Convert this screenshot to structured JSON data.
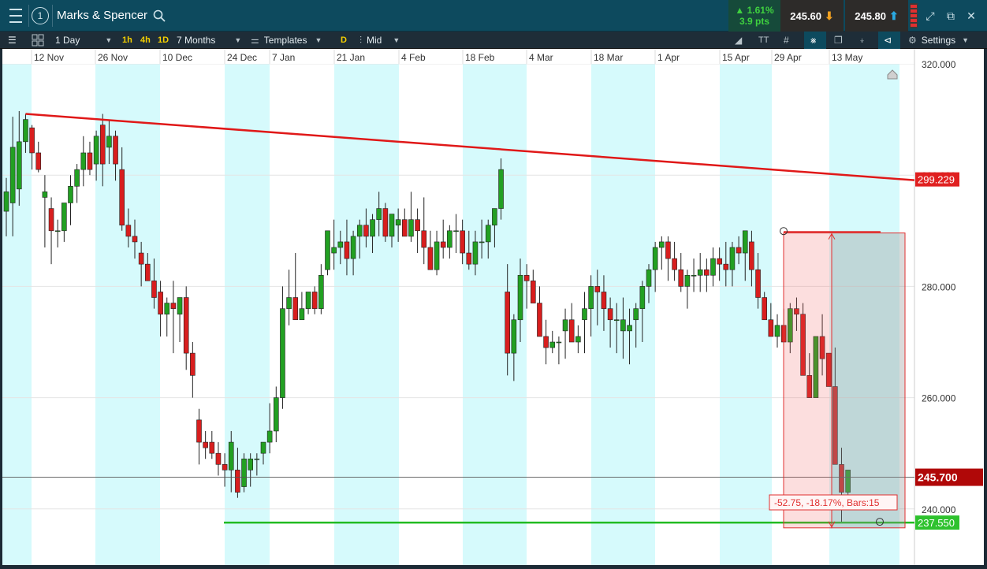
{
  "header": {
    "instrument": "Marks & Spencer",
    "info_badge": "1",
    "change_pct": "1.61%",
    "change_pts": "3.9 pts",
    "sell_price": "245.60",
    "buy_price": "245.80"
  },
  "toolbar": {
    "interval": "1 Day",
    "quick_intervals": [
      "1h",
      "4h",
      "1D"
    ],
    "range": "7 Months",
    "templates": "Templates",
    "price_type_badge": "D",
    "price_type": "Mid",
    "settings": "Settings"
  },
  "colors": {
    "up_candle": "#22a022",
    "down_candle": "#d81e1e",
    "trendline": "#e01818",
    "support": "#22bb22",
    "shade": "#d6fafc"
  },
  "chart_data": {
    "type": "candlestick",
    "x_labels": [
      "12 Nov",
      "26 Nov",
      "10 Dec",
      "24 Dec",
      "7 Jan",
      "21 Jan",
      "4 Feb",
      "18 Feb",
      "4 Mar",
      "18 Mar",
      "1 Apr",
      "15 Apr",
      "29 Apr",
      "13 May"
    ],
    "y_ticks": [
      "320.000",
      "300.000",
      "280.000",
      "260.000",
      "240.000"
    ],
    "y_range": [
      237,
      321
    ],
    "price_tags": {
      "trendline": "299.229",
      "current": "245.700",
      "support": "237.550"
    },
    "measure_label": "-52.75, -18.17%, Bars:15",
    "candles": [
      [
        293.5,
        299.5,
        289,
        297
      ],
      [
        295,
        310.5,
        289,
        305
      ],
      [
        297.5,
        311.5,
        294.5,
        306
      ],
      [
        306,
        311,
        304,
        310
      ],
      [
        308.5,
        309,
        301,
        304
      ],
      [
        304,
        306,
        300.5,
        301
      ],
      [
        296,
        300,
        287,
        297
      ],
      [
        294,
        296,
        284,
        290
      ],
      [
        290,
        292,
        287,
        290
      ],
      [
        290,
        294,
        288,
        295
      ],
      [
        295,
        300,
        291,
        298
      ],
      [
        298,
        302,
        295,
        301
      ],
      [
        301,
        307,
        298,
        304
      ],
      [
        304,
        306,
        300,
        301
      ],
      [
        302,
        308,
        299,
        307
      ],
      [
        309,
        311,
        298,
        302
      ],
      [
        305,
        310,
        302,
        307
      ],
      [
        307,
        308,
        299,
        302
      ],
      [
        301,
        305,
        290,
        291
      ],
      [
        291,
        294,
        287,
        289
      ],
      [
        289,
        292,
        285,
        288
      ],
      [
        286,
        288,
        280,
        284
      ],
      [
        284,
        286,
        281,
        281
      ],
      [
        281,
        285,
        276,
        278
      ],
      [
        279,
        281,
        271,
        275
      ],
      [
        275,
        278,
        271,
        277
      ],
      [
        277,
        281,
        268,
        276
      ],
      [
        275,
        278,
        270,
        278
      ],
      [
        278,
        280,
        265,
        268
      ],
      [
        268,
        270,
        260,
        264
      ],
      [
        256,
        258,
        248,
        252
      ],
      [
        252,
        254,
        249,
        251
      ],
      [
        252,
        254,
        249,
        250
      ],
      [
        250,
        252,
        246,
        248
      ],
      [
        248,
        250,
        244,
        247
      ],
      [
        247,
        254,
        243,
        252
      ],
      [
        247,
        251,
        242,
        243
      ],
      [
        244,
        250,
        243,
        249
      ],
      [
        247,
        250,
        244,
        249
      ],
      [
        249,
        250,
        246,
        249
      ],
      [
        250,
        252,
        248,
        252
      ],
      [
        252,
        259,
        250,
        254
      ],
      [
        254,
        262,
        252,
        260
      ],
      [
        260,
        280,
        258,
        276
      ],
      [
        276,
        283,
        273,
        278
      ],
      [
        278,
        286,
        274,
        274
      ],
      [
        274,
        279,
        274,
        276
      ],
      [
        276,
        279,
        275,
        279
      ],
      [
        279,
        280,
        275,
        276
      ],
      [
        276,
        284,
        275,
        282
      ],
      [
        283,
        290,
        282,
        290
      ],
      [
        286,
        292,
        283,
        287
      ],
      [
        287,
        290,
        284,
        288
      ],
      [
        288,
        292,
        282,
        285
      ],
      [
        285,
        290,
        282,
        289
      ],
      [
        289,
        292,
        285,
        291
      ],
      [
        291,
        294,
        287,
        289
      ],
      [
        289,
        293,
        286,
        292
      ],
      [
        292,
        297,
        289,
        294
      ],
      [
        294,
        295,
        288,
        289
      ],
      [
        289,
        292,
        287,
        293
      ],
      [
        291,
        294,
        288,
        292
      ],
      [
        292,
        294,
        289,
        289
      ],
      [
        289,
        297,
        288,
        292
      ],
      [
        292,
        294,
        286,
        290
      ],
      [
        290,
        296,
        284,
        287
      ],
      [
        287,
        290,
        283,
        283
      ],
      [
        283,
        290,
        282,
        288
      ],
      [
        288,
        292,
        285,
        287
      ],
      [
        287,
        291,
        285,
        290
      ],
      [
        290,
        293,
        286,
        290
      ],
      [
        290,
        292,
        284,
        286
      ],
      [
        286,
        290,
        283,
        284
      ],
      [
        284,
        290,
        282,
        288
      ],
      [
        288,
        292,
        285,
        288
      ],
      [
        288,
        292,
        285,
        291
      ],
      [
        291,
        294,
        287,
        294
      ],
      [
        294,
        303,
        292,
        301
      ],
      [
        279,
        284,
        264,
        268
      ],
      [
        268,
        275,
        263,
        274
      ],
      [
        274,
        285,
        270,
        282
      ],
      [
        282,
        284,
        276,
        281
      ],
      [
        281,
        283,
        277,
        277
      ],
      [
        277,
        280,
        271,
        271
      ],
      [
        271,
        274,
        266,
        269
      ],
      [
        269,
        272,
        268,
        270
      ],
      [
        270,
        271,
        266,
        270
      ],
      [
        272,
        276,
        267,
        274
      ],
      [
        274,
        277,
        270,
        270
      ],
      [
        270,
        273,
        268,
        271
      ],
      [
        274,
        279,
        268,
        276
      ],
      [
        276,
        282,
        271,
        280
      ],
      [
        280,
        283,
        273,
        279
      ],
      [
        279,
        282,
        272,
        276
      ],
      [
        276,
        278,
        269,
        274
      ],
      [
        274,
        277,
        268,
        274
      ],
      [
        272,
        278,
        267,
        274
      ],
      [
        272,
        276,
        266,
        273
      ],
      [
        274,
        277,
        269,
        276
      ],
      [
        276,
        281,
        270,
        280
      ],
      [
        280,
        284,
        277,
        283
      ],
      [
        283,
        288,
        279,
        287
      ],
      [
        287,
        289,
        283,
        288
      ],
      [
        288,
        289,
        281,
        285
      ],
      [
        285,
        288,
        281,
        283
      ],
      [
        283,
        286,
        279,
        280
      ],
      [
        280,
        283,
        276,
        282
      ],
      [
        282,
        285,
        279,
        282
      ],
      [
        282,
        286,
        279,
        283
      ],
      [
        283,
        285,
        279,
        282
      ],
      [
        282,
        287,
        280,
        285
      ],
      [
        285,
        287,
        281,
        284
      ],
      [
        284,
        288,
        280,
        283
      ],
      [
        283,
        288,
        280,
        287
      ],
      [
        287,
        289,
        284,
        286
      ],
      [
        286,
        290,
        281,
        290
      ],
      [
        288,
        290,
        280,
        283
      ],
      [
        283,
        286,
        276,
        278
      ],
      [
        278,
        279,
        274,
        274
      ],
      [
        274,
        277,
        271,
        271
      ],
      [
        271,
        275,
        269,
        273
      ],
      [
        273,
        276,
        270,
        270
      ],
      [
        270,
        277,
        268,
        276
      ],
      [
        276,
        278,
        272,
        275
      ],
      [
        275,
        277,
        270,
        264
      ],
      [
        264,
        268,
        260,
        260
      ],
      [
        260,
        262,
        262,
        271
      ],
      [
        271,
        275,
        264,
        267
      ],
      [
        268,
        267,
        262,
        262
      ],
      [
        262,
        269,
        250,
        248
      ],
      [
        248,
        251,
        237.5,
        243
      ],
      [
        243,
        247,
        241,
        247
      ]
    ]
  }
}
